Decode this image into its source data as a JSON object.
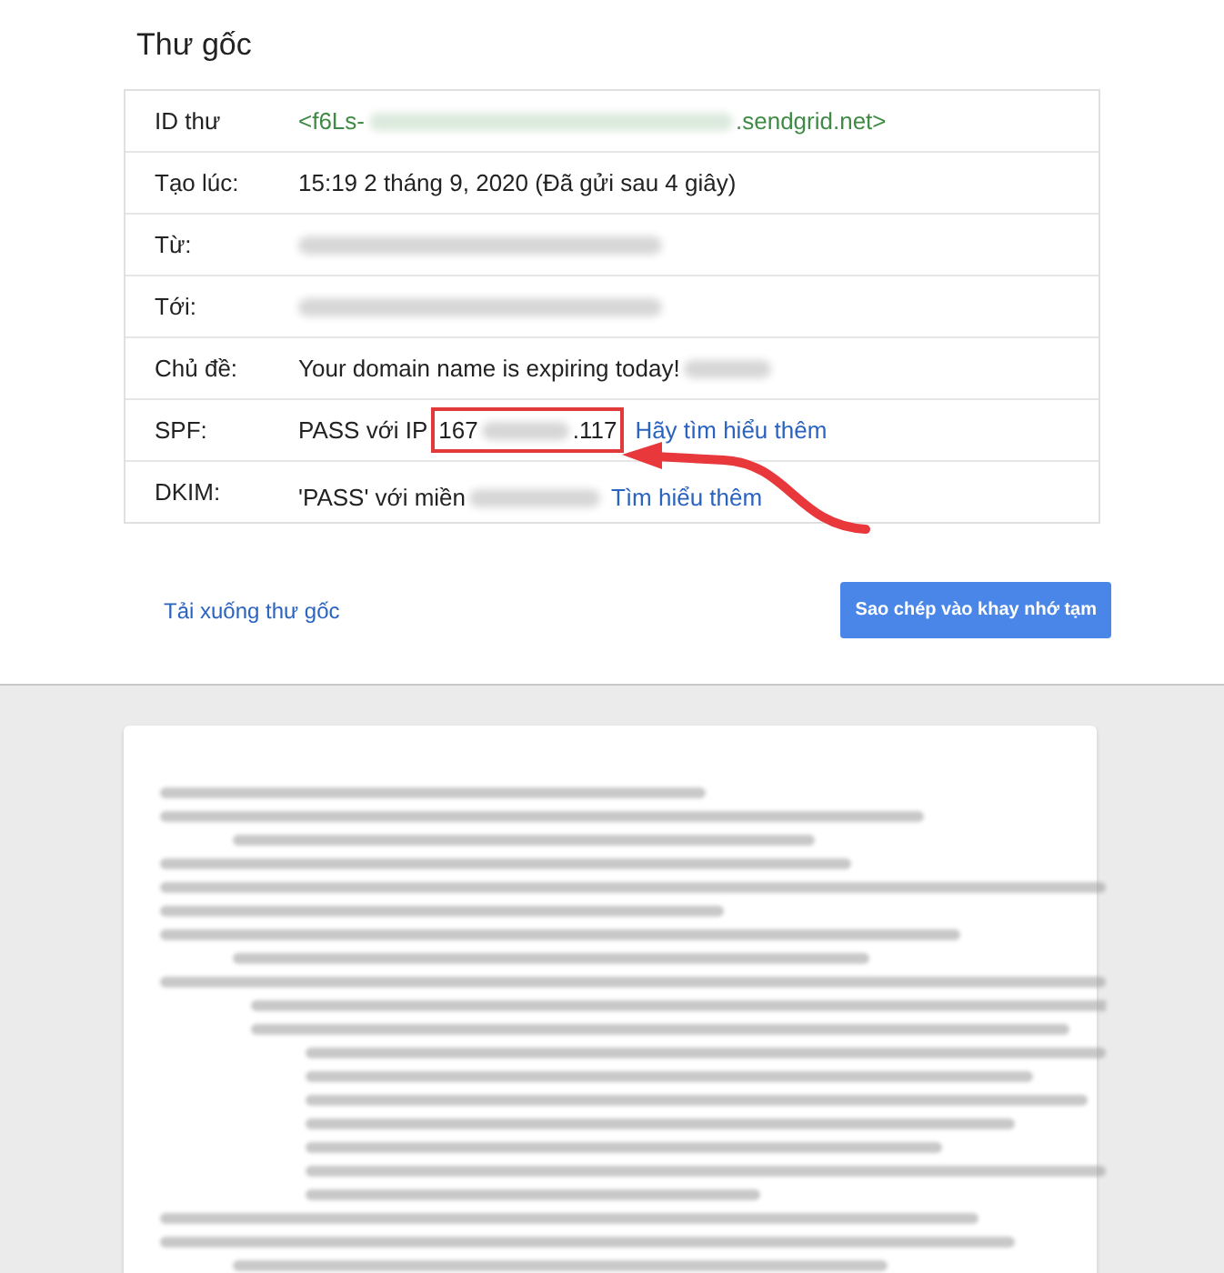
{
  "title": "Thư gốc",
  "rows": [
    {
      "label": "ID thư",
      "kind": "id",
      "value": [
        {
          "kind": "text",
          "text": "<f6Ls-"
        },
        {
          "kind": "redacted"
        },
        {
          "kind": "text",
          "text": ".sendgrid.net>"
        }
      ]
    },
    {
      "label": "Tạo lúc:",
      "kind": "plain",
      "value": [
        {
          "kind": "text",
          "text": "15:19 2 tháng 9, 2020 (Đã gửi sau 4 giây)"
        }
      ]
    },
    {
      "label": "Từ:",
      "kind": "plain",
      "value": [
        {
          "kind": "redacted"
        }
      ]
    },
    {
      "label": "Tới:",
      "kind": "plain",
      "value": [
        {
          "kind": "redacted"
        }
      ]
    },
    {
      "label": "Chủ đề:",
      "kind": "plain",
      "value": [
        {
          "kind": "text",
          "text": "Your domain name is expiring today!"
        },
        {
          "kind": "redacted"
        }
      ]
    },
    {
      "label": "SPF:",
      "kind": "plain",
      "value": [
        {
          "kind": "text",
          "text": "PASS với IP"
        },
        {
          "kind": "boxed",
          "parts": [
            {
              "kind": "text",
              "text": "167"
            },
            {
              "kind": "redacted"
            },
            {
              "kind": "text",
              "text": ".117"
            }
          ]
        },
        {
          "kind": "link",
          "text": "Hãy tìm hiểu thêm"
        }
      ]
    },
    {
      "label": "DKIM:",
      "kind": "plain",
      "value": [
        {
          "kind": "text",
          "text": "'PASS' với miền"
        },
        {
          "kind": "redacted"
        },
        {
          "kind": "link",
          "text": "Tìm hiểu thêm"
        }
      ]
    }
  ],
  "download_link": "Tải xuống thư gốc",
  "copy_button": "Sao chép vào khay nhớ tạm"
}
